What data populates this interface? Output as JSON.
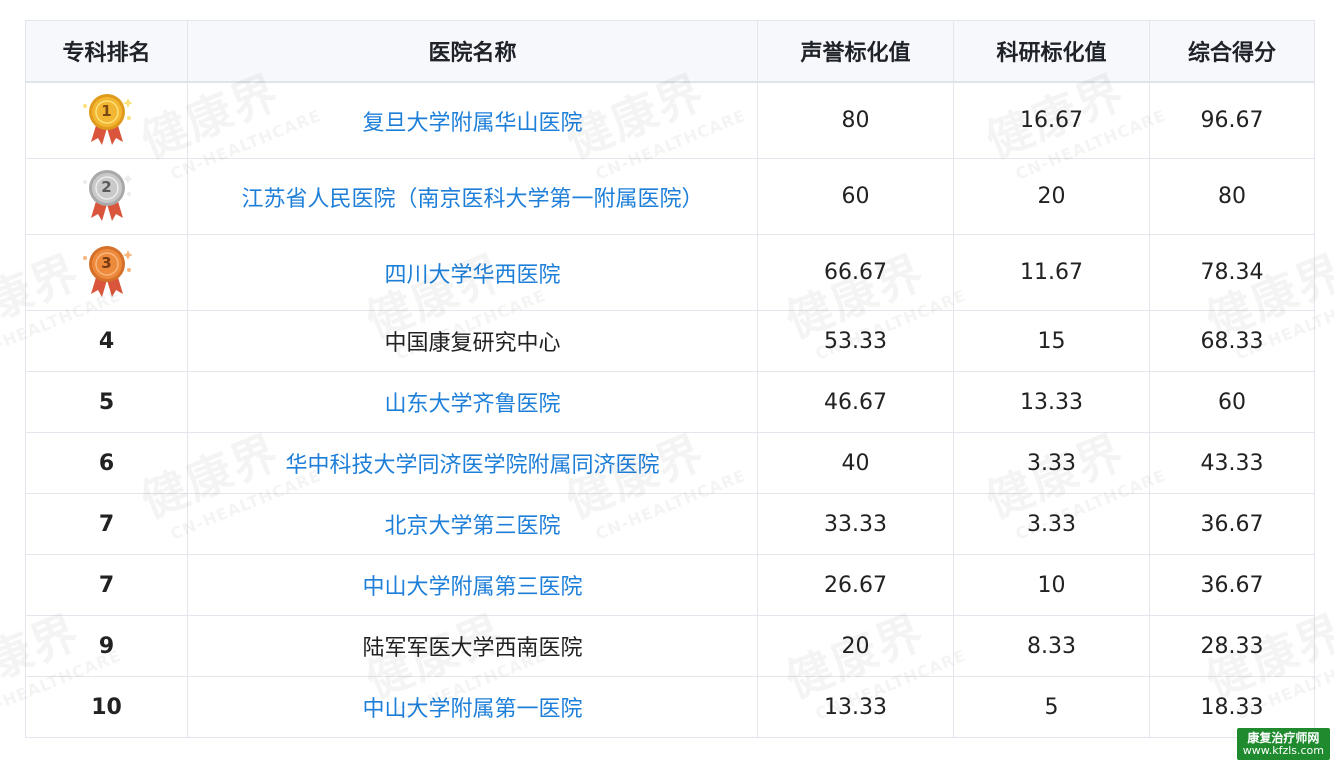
{
  "table": {
    "headers": [
      "专科排名",
      "医院名称",
      "声誉标化值",
      "科研标化值",
      "综合得分"
    ],
    "rows": [
      {
        "rank": "1",
        "medal": "gold",
        "hospital": "复旦大学附属华山医院",
        "linked": true,
        "reputation": "80",
        "research": "16.67",
        "total": "96.67"
      },
      {
        "rank": "2",
        "medal": "silver",
        "hospital": "江苏省人民医院（南京医科大学第一附属医院）",
        "linked": true,
        "reputation": "60",
        "research": "20",
        "total": "80"
      },
      {
        "rank": "3",
        "medal": "bronze",
        "hospital": "四川大学华西医院",
        "linked": true,
        "reputation": "66.67",
        "research": "11.67",
        "total": "78.34"
      },
      {
        "rank": "4",
        "medal": null,
        "hospital": "中国康复研究中心",
        "linked": false,
        "reputation": "53.33",
        "research": "15",
        "total": "68.33"
      },
      {
        "rank": "5",
        "medal": null,
        "hospital": "山东大学齐鲁医院",
        "linked": true,
        "reputation": "46.67",
        "research": "13.33",
        "total": "60"
      },
      {
        "rank": "6",
        "medal": null,
        "hospital": "华中科技大学同济医学院附属同济医院",
        "linked": true,
        "reputation": "40",
        "research": "3.33",
        "total": "43.33"
      },
      {
        "rank": "7",
        "medal": null,
        "hospital": "北京大学第三医院",
        "linked": true,
        "reputation": "33.33",
        "research": "3.33",
        "total": "36.67"
      },
      {
        "rank": "7",
        "medal": null,
        "hospital": "中山大学附属第三医院",
        "linked": true,
        "reputation": "26.67",
        "research": "10",
        "total": "36.67"
      },
      {
        "rank": "9",
        "medal": null,
        "hospital": "陆军军医大学西南医院",
        "linked": false,
        "reputation": "20",
        "research": "8.33",
        "total": "28.33"
      },
      {
        "rank": "10",
        "medal": null,
        "hospital": "中山大学附属第一医院",
        "linked": true,
        "reputation": "13.33",
        "research": "5",
        "total": "18.33"
      }
    ]
  },
  "watermark": {
    "main": "健康界",
    "sub": "CN-HEALTHCARE"
  },
  "badge": {
    "line1": "康复治疗师网",
    "line2": "www.kfzls.com"
  },
  "colors": {
    "link": "#1e7fd9",
    "header_bg": "#f6f8fc",
    "border": "#e3e6ec",
    "gold": "#f2b632",
    "silver": "#c9c9c9",
    "bronze": "#ee8a3c",
    "ribbon": "#d9553b",
    "badge_bg": "#1f8a2e"
  }
}
